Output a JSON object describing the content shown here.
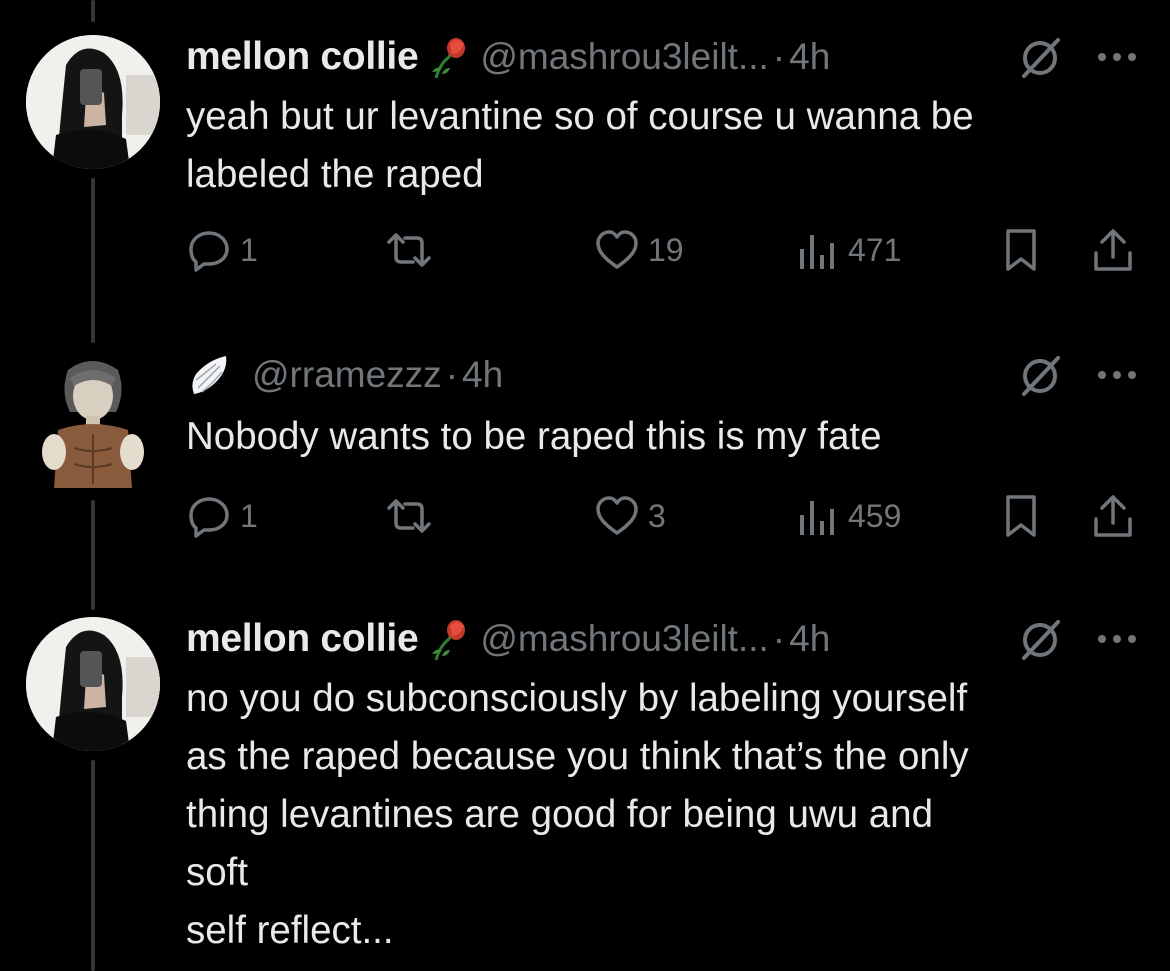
{
  "tweets": [
    {
      "display_name": "mellon collie",
      "handle": "@mashrou3leilt...",
      "dot": "·",
      "time": "4h",
      "badge_icon": "wilted-rose-icon",
      "avatar": "mirror-selfie-avatar",
      "text_lines": [
        "yeah but ur levantine so of course u wanna be",
        "labeled the raped"
      ],
      "actions": {
        "replies": "1",
        "retweets": "",
        "likes": "19",
        "views": "471"
      }
    },
    {
      "display_name": "",
      "handle": "@rramezzz",
      "dot": "·",
      "time": "4h",
      "badge_icon": "angel-wing-icon",
      "avatar": "illustrated-character-avatar",
      "text_lines": [
        "Nobody wants to be raped this is my fate"
      ],
      "actions": {
        "replies": "1",
        "retweets": "",
        "likes": "3",
        "views": "459"
      }
    },
    {
      "display_name": "mellon collie",
      "handle": "@mashrou3leilt...",
      "dot": "·",
      "time": "4h",
      "badge_icon": "wilted-rose-icon",
      "avatar": "mirror-selfie-avatar",
      "text_lines": [
        "no you do subconsciously by labeling yourself",
        "as the raped because you think that’s the only",
        "thing levantines are good for being uwu and",
        "soft",
        "self reflect..."
      ],
      "actions": {
        "replies": "",
        "retweets": "",
        "likes": "",
        "views": ""
      }
    }
  ],
  "colors": {
    "background": "#000000",
    "text": "#e7e9ea",
    "muted": "#71767b",
    "thread_line": "#333639",
    "rose": "#c0392b",
    "stem": "#2e7d32"
  }
}
